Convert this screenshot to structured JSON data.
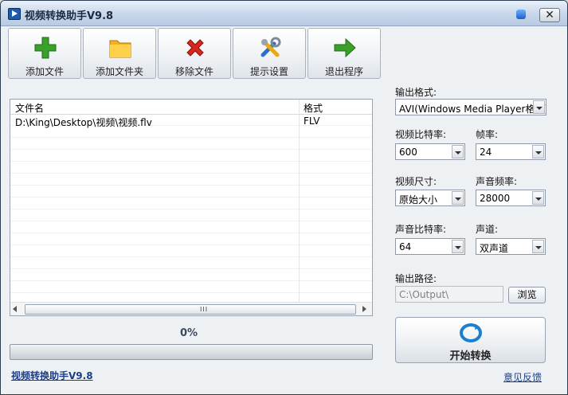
{
  "window": {
    "title": "视频转换助手V9.8",
    "close_label": "✕"
  },
  "toolbar": {
    "buttons": [
      {
        "id": "add-file",
        "label": "添加文件",
        "icon": "plus-icon",
        "color": "#3aa02a"
      },
      {
        "id": "add-folder",
        "label": "添加文件夹",
        "icon": "folder-icon",
        "color": "#f0b21e"
      },
      {
        "id": "remove-file",
        "label": "移除文件",
        "icon": "delete-x-icon",
        "color": "#d7261e"
      },
      {
        "id": "settings",
        "label": "提示设置",
        "icon": "tools-icon",
        "color": "#2a6fd0"
      },
      {
        "id": "exit",
        "label": "退出程序",
        "icon": "arrow-right-icon",
        "color": "#3aa02a"
      }
    ]
  },
  "file_list": {
    "headers": {
      "name": "文件名",
      "format": "格式"
    },
    "rows": [
      {
        "name": "D:\\King\\Desktop\\视频\\视频.flv",
        "format": "FLV"
      }
    ],
    "scroll_grip": "III"
  },
  "progress": {
    "percent_text": "0%",
    "value": 0
  },
  "footer": {
    "app_link": "视频转换助手V9.8",
    "feedback": "意见反馈"
  },
  "settings": {
    "output_format_label": "输出格式:",
    "output_format_value": "AVI(Windows Media Player格式)",
    "video_bitrate_label": "视频比特率:",
    "video_bitrate_value": "600",
    "frame_rate_label": "帧率:",
    "frame_rate_value": "24",
    "video_size_label": "视频尺寸:",
    "video_size_value": "原始大小",
    "audio_freq_label": "声音频率:",
    "audio_freq_value": "28000",
    "audio_bitrate_label": "声音比特率:",
    "audio_bitrate_value": "64",
    "channel_label": "声道:",
    "channel_value": "双声道",
    "output_path_label": "输出路径:",
    "output_path_value": "C:\\Output\\",
    "browse_label": "浏览",
    "start_label": "开始转换"
  }
}
